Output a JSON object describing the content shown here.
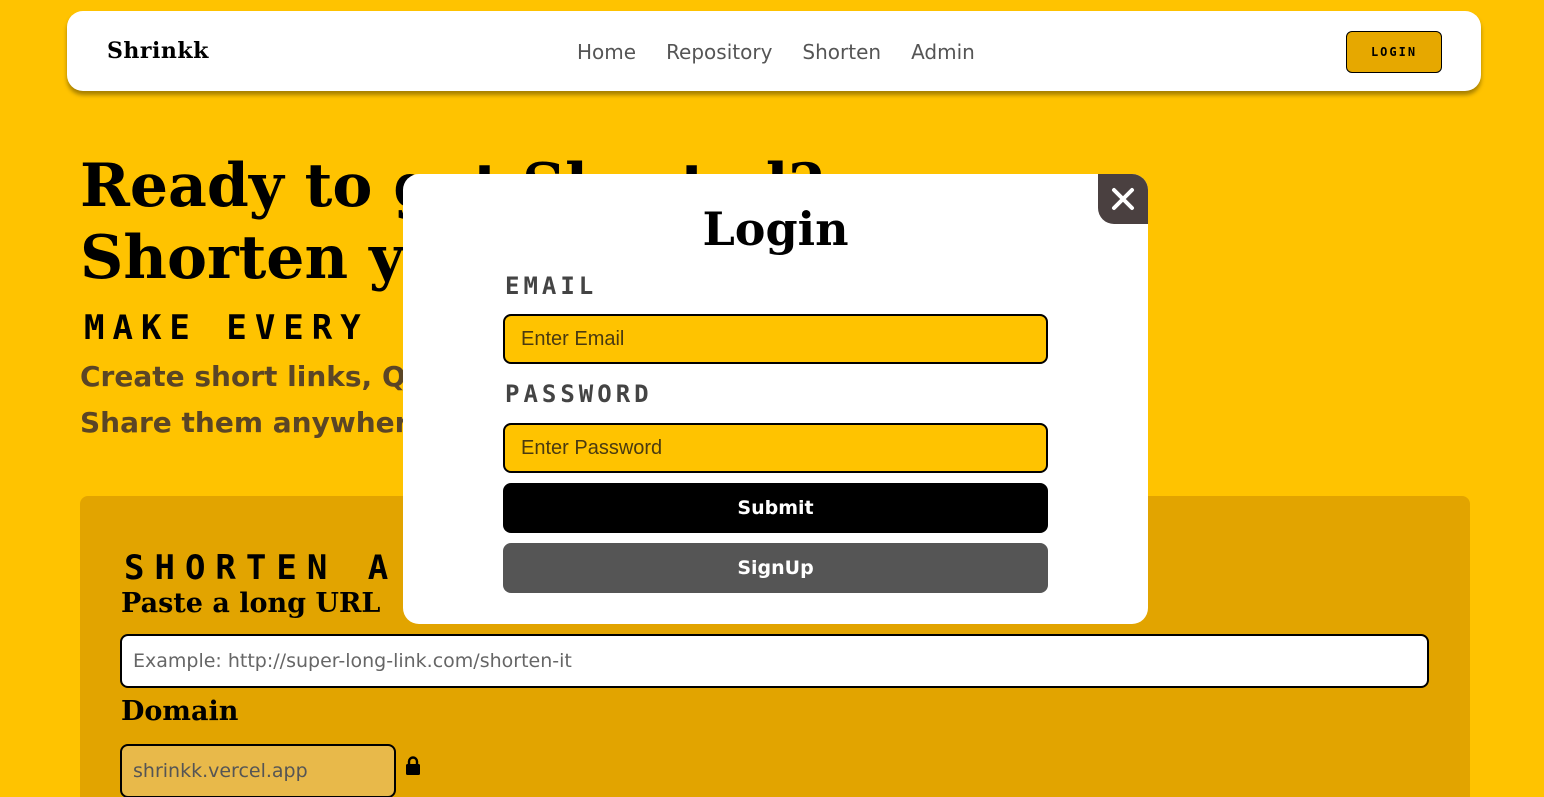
{
  "navbar": {
    "brand": "Shrinkk",
    "links": [
      "Home",
      "Repository",
      "Shorten",
      "Admin"
    ],
    "login_label": "LOGIN"
  },
  "hero": {
    "title": "Ready to get Shorted? Shorten your first link",
    "tagline": "MAKE EVERY",
    "desc_line1": "Create short links, QR",
    "desc_line2": "Share them anywhere"
  },
  "shorten": {
    "heading": "SHORTEN A",
    "url_label": "Paste a long URL",
    "url_placeholder": "Example: http://super-long-link.com/shorten-it",
    "domain_label": "Domain",
    "domain_value": "shrinkk.vercel.app"
  },
  "modal": {
    "title": "Login",
    "email_label": "EMAIL",
    "email_placeholder": "Enter Email",
    "password_label": "PASSWORD",
    "password_placeholder": "Enter Password",
    "submit_label": "Submit",
    "signup_label": "SignUp"
  },
  "colors": {
    "background": "#FFC300",
    "panel": "#E2A400",
    "modal_close": "#4a4040",
    "signup_button": "#555555"
  }
}
